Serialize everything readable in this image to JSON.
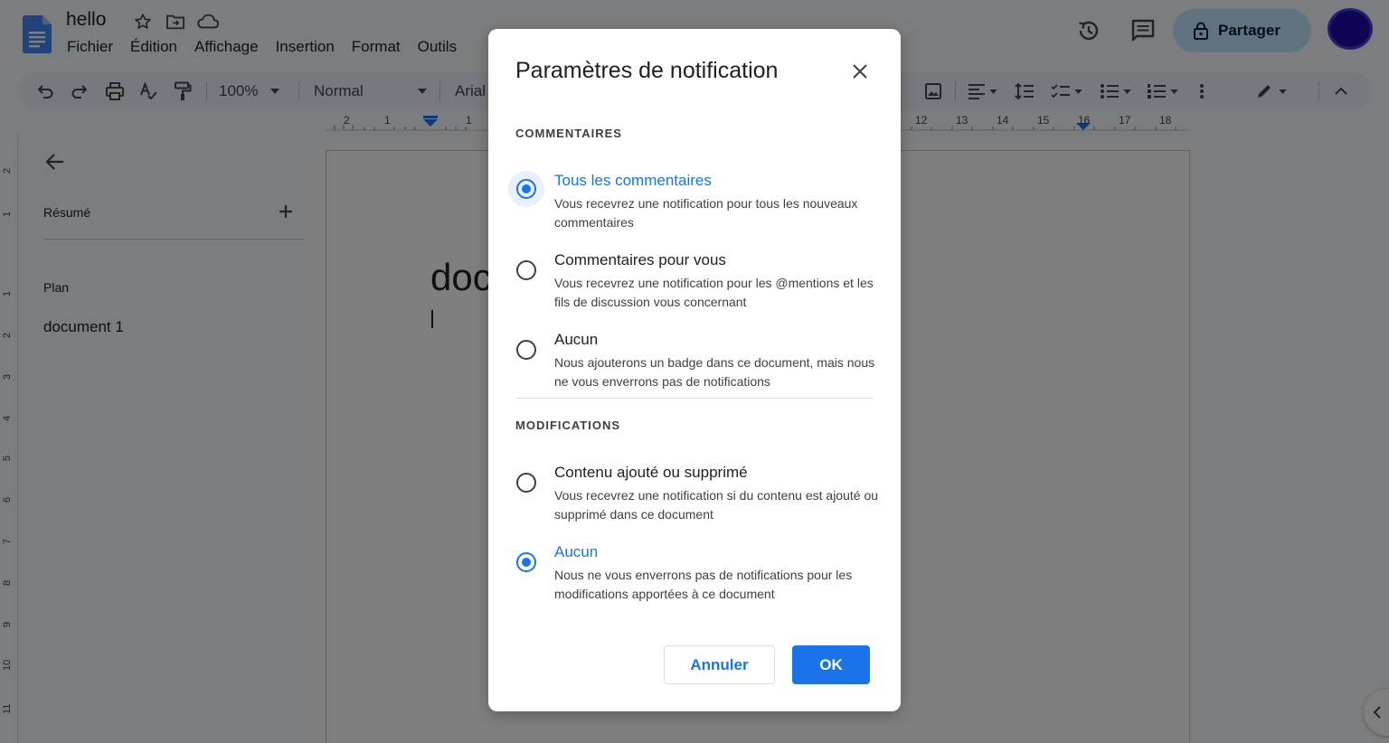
{
  "document": {
    "title": "hello",
    "menus": [
      "Fichier",
      "Édition",
      "Affichage",
      "Insertion",
      "Format",
      "Outils"
    ],
    "share_label": "Partager",
    "toolbar": {
      "zoom": "100%",
      "style": "Normal",
      "font": "Arial"
    },
    "ruler_numbers_left": [
      "2",
      "1",
      "1"
    ],
    "ruler_numbers_right": [
      "12",
      "13",
      "14",
      "15",
      "16",
      "17",
      "18"
    ],
    "vertical_ruler_numbers": [
      "2",
      "1",
      "1",
      "2",
      "3",
      "4",
      "5",
      "6",
      "7",
      "8",
      "9",
      "10",
      "11"
    ],
    "sidebar": {
      "summary_label": "Résumé",
      "outline_label": "Plan",
      "outline_items": [
        "document 1"
      ]
    },
    "page_text_visible": "doc"
  },
  "dialog": {
    "title": "Paramètres de notification",
    "sections": [
      {
        "label": "COMMENTAIRES",
        "options": [
          {
            "title": "Tous les commentaires",
            "description": "Vous recevrez une notification pour tous les nouveaux commentaires",
            "selected": true
          },
          {
            "title": "Commentaires pour vous",
            "description": "Vous recevrez une notification pour les @mentions et les fils de discussion vous concernant",
            "selected": false
          },
          {
            "title": "Aucun",
            "description": "Nous ajouterons un badge dans ce document, mais nous ne vous enverrons pas de notifications",
            "selected": false
          }
        ]
      },
      {
        "label": "MODIFICATIONS",
        "options": [
          {
            "title": "Contenu ajouté ou supprimé",
            "description": "Vous recevrez une notification si du contenu est ajouté ou supprimé dans ce document",
            "selected": false
          },
          {
            "title": "Aucun",
            "description": "Nous ne vous enverrons pas de notifications pour les modifications apportées à ce document",
            "selected": true
          }
        ]
      }
    ],
    "cancel_label": "Annuler",
    "ok_label": "OK"
  },
  "colors": {
    "accent": "#1a73e8",
    "share_bg": "#c2e7ff",
    "avatar": "#1a0dab"
  }
}
